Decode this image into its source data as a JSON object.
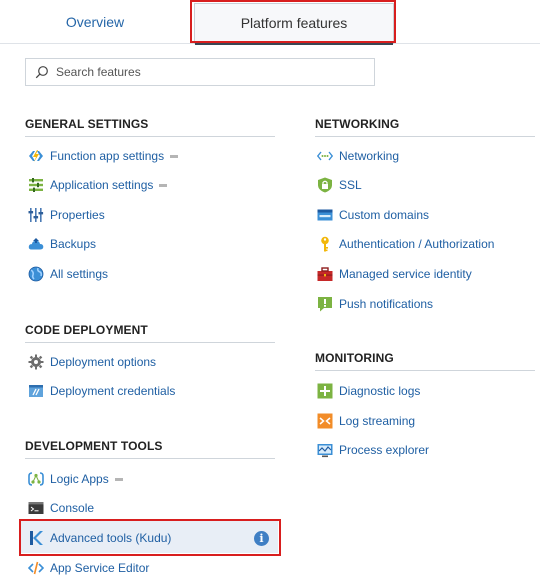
{
  "tabs": {
    "overview": "Overview",
    "platform": "Platform features"
  },
  "search": {
    "placeholder": "Search features"
  },
  "sections": {
    "general": {
      "title": "GENERAL SETTINGS",
      "items": [
        "Function app settings",
        "Application settings",
        "Properties",
        "Backups",
        "All settings"
      ]
    },
    "code_deployment": {
      "title": "CODE DEPLOYMENT",
      "items": [
        "Deployment options",
        "Deployment credentials"
      ]
    },
    "dev_tools": {
      "title": "DEVELOPMENT TOOLS",
      "items": [
        "Logic Apps",
        "Console",
        "Advanced tools (Kudu)",
        "App Service Editor"
      ]
    },
    "networking": {
      "title": "NETWORKING",
      "items": [
        "Networking",
        "SSL",
        "Custom domains",
        "Authentication / Authorization",
        "Managed service identity",
        "Push notifications"
      ]
    },
    "monitoring": {
      "title": "MONITORING",
      "items": [
        "Diagnostic logs",
        "Log streaming",
        "Process explorer"
      ]
    }
  },
  "icons": {
    "info": "i"
  }
}
